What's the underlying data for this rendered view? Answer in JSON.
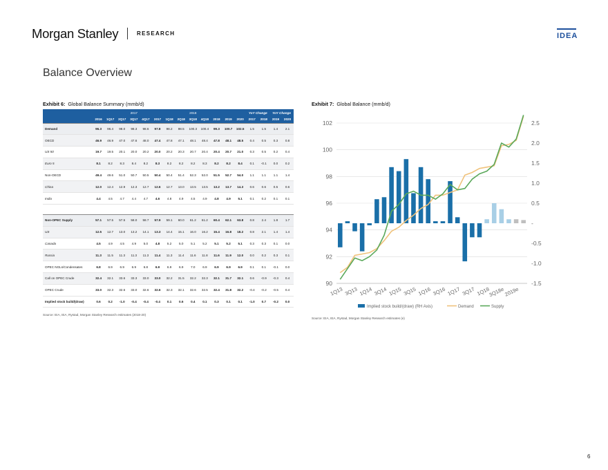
{
  "header": {
    "brand": "Morgan Stanley",
    "section": "RESEARCH",
    "tag": "IDEA"
  },
  "page_title": "Balance Overview",
  "exhibit6": {
    "label": "Exhibit 6:",
    "title": "Global Balance Summary (mmb/d)",
    "source": "Source: EIA, IEA, Rystad, Morgan Stanley Research estimates (2018-20)",
    "group_headers": [
      "2017",
      "2018",
      "YoY Change",
      "YoY Change"
    ],
    "columns": [
      "2016",
      "1Q17",
      "2Q17",
      "3Q17",
      "4Q17",
      "2017",
      "1Q18",
      "2Q18",
      "3Q18",
      "4Q18",
      "2018",
      "2019",
      "2020",
      "2017",
      "2018",
      "2019",
      "2020"
    ],
    "rows": [
      {
        "label": "Demand",
        "values": [
          "96.3",
          "96.4",
          "98.0",
          "98.3",
          "98.6",
          "97.8",
          "98.2",
          "98.5",
          "100.3",
          "100.4",
          "99.3",
          "100.7",
          "102.5",
          "1.5",
          "1.5",
          "1.4",
          "2.1"
        ]
      },
      {
        "label": "OECD",
        "values": [
          "46.9",
          "46.9",
          "47.0",
          "47.6",
          "48.0",
          "47.4",
          "47.8",
          "47.1",
          "48.1",
          "48.4",
          "47.8",
          "48.1",
          "48.5",
          "0.4",
          "0.5",
          "0.3",
          "0.8"
        ]
      },
      {
        "label": "US 50",
        "values": [
          "19.7",
          "19.5",
          "20.1",
          "20.0",
          "20.2",
          "20.0",
          "20.2",
          "20.3",
          "20.7",
          "20.4",
          "20.4",
          "20.7",
          "21.0",
          "0.3",
          "0.5",
          "0.2",
          "0.4"
        ]
      },
      {
        "label": "Euro 5",
        "values": [
          "8.1",
          "8.2",
          "8.3",
          "8.4",
          "8.2",
          "8.3",
          "8.2",
          "8.2",
          "8.2",
          "8.3",
          "8.2",
          "8.2",
          "8.4",
          "0.1",
          "-0.1",
          "0.0",
          "0.2"
        ]
      },
      {
        "label": "Non-OECD",
        "values": [
          "49.4",
          "49.6",
          "51.0",
          "50.7",
          "50.5",
          "50.4",
          "50.4",
          "51.4",
          "52.3",
          "52.0",
          "51.5",
          "52.7",
          "54.0",
          "1.1",
          "1.1",
          "1.1",
          "1.4"
        ]
      },
      {
        "label": "China",
        "values": [
          "12.0",
          "12.4",
          "12.9",
          "12.3",
          "12.7",
          "12.6",
          "12.7",
          "13.0",
          "13.5",
          "13.5",
          "13.2",
          "13.7",
          "14.3",
          "0.6",
          "0.6",
          "0.5",
          "0.6"
        ]
      },
      {
        "label": "India",
        "values": [
          "4.4",
          "4.5",
          "4.7",
          "4.4",
          "4.7",
          "4.6",
          "4.8",
          "4.9",
          "4.5",
          "4.9",
          "4.8",
          "4.9",
          "5.1",
          "0.1",
          "0.2",
          "0.1",
          "0.1"
        ]
      },
      {
        "label": "Non-OPEC Supply",
        "values": [
          "57.1",
          "57.5",
          "57.5",
          "58.0",
          "58.7",
          "57.9",
          "59.1",
          "60.0",
          "61.2",
          "61.2",
          "60.4",
          "62.1",
          "63.8",
          "0.8",
          "2.4",
          "1.8",
          "1.7"
        ]
      },
      {
        "label": "US",
        "values": [
          "12.5",
          "12.7",
          "13.0",
          "13.2",
          "14.1",
          "13.3",
          "14.4",
          "15.1",
          "16.0",
          "16.2",
          "15.4",
          "16.8",
          "18.2",
          "0.8",
          "2.1",
          "1.4",
          "1.4"
        ]
      },
      {
        "label": "Canada",
        "values": [
          "4.5",
          "4.9",
          "4.5",
          "4.9",
          "5.0",
          "4.8",
          "5.2",
          "5.0",
          "5.1",
          "5.2",
          "5.1",
          "5.2",
          "5.1",
          "0.3",
          "0.3",
          "0.1",
          "0.0"
        ]
      },
      {
        "label": "Russia",
        "values": [
          "11.3",
          "11.5",
          "11.3",
          "11.3",
          "11.3",
          "11.4",
          "11.3",
          "11.4",
          "11.6",
          "11.8",
          "11.6",
          "11.9",
          "12.0",
          "0.0",
          "0.2",
          "0.3",
          "0.1"
        ]
      },
      {
        "label": "OPEC NGLs/Condensates",
        "values": [
          "6.8",
          "6.9",
          "6.9",
          "6.9",
          "6.8",
          "6.9",
          "6.9",
          "6.9",
          "7.0",
          "6.9",
          "6.9",
          "6.9",
          "6.9",
          "0.1",
          "0.1",
          "-0.1",
          "0.0"
        ]
      },
      {
        "label": "Call on OPEC Crude",
        "values": [
          "32.4",
          "32.1",
          "33.6",
          "33.3",
          "33.0",
          "33.0",
          "32.2",
          "31.5",
          "32.2",
          "32.3",
          "32.1",
          "31.7",
          "32.1",
          "0.6",
          "-0.9",
          "-0.3",
          "0.4"
        ]
      },
      {
        "label": "OPEC Crude",
        "values": [
          "33.0",
          "32.3",
          "32.6",
          "33.0",
          "32.6",
          "32.6",
          "32.3",
          "32.1",
          "32.6",
          "32.5",
          "32.4",
          "31.8",
          "32.2",
          "-0.4",
          "-0.2",
          "-0.5",
          "0.4"
        ]
      },
      {
        "label": "Implied stock build/(draw)",
        "values": [
          "0.6",
          "0.2",
          "-1.0",
          "-0.4",
          "-0.4",
          "-0.4",
          "0.1",
          "0.6",
          "0.4",
          "0.1",
          "0.3",
          "0.1",
          "0.1",
          "-1.0",
          "0.7",
          "-0.2",
          "0.0"
        ]
      }
    ]
  },
  "exhibit7": {
    "label": "Exhibit 7:",
    "title": "Global Balance (mmb/d)",
    "source": "Source: EIA, IEA, Rystad, Morgan Stanley Research estimates (e)"
  },
  "chart_data": {
    "type": "bar",
    "x": [
      "1Q13",
      "2Q13",
      "3Q13",
      "4Q13",
      "1Q14",
      "2Q14",
      "3Q14",
      "4Q14",
      "1Q15",
      "2Q15",
      "3Q15",
      "4Q15",
      "1Q16",
      "2Q16",
      "3Q16",
      "4Q16",
      "1Q17",
      "2Q17",
      "3Q17",
      "4Q17",
      "1Q18",
      "2Q18",
      "3Q18e",
      "4Q18e",
      "2019e",
      "2020e"
    ],
    "x_tick_labels": [
      "1Q13",
      "3Q13",
      "1Q14",
      "3Q14",
      "1Q15",
      "3Q15",
      "1Q16",
      "3Q16",
      "1Q17",
      "3Q17",
      "1Q18",
      "3Q18e",
      "2019e"
    ],
    "left_axis": {
      "ylim": [
        90,
        102
      ],
      "ticks": [
        "90",
        "92",
        "94",
        "96",
        "98",
        "100",
        "102"
      ]
    },
    "right_axis": {
      "ylim": [
        -1.5,
        2.5
      ],
      "ticks": [
        "-1.5",
        "-1.0",
        "-0.5",
        "-",
        "0.5",
        "1.0",
        "1.5",
        "2.0",
        "2.5"
      ]
    },
    "series": [
      {
        "name": "Implied stock build/(draw) (RH Axis)",
        "axis": "right",
        "kind": "bar",
        "color": "#1a6fa8",
        "values": [
          -0.6,
          0.05,
          -0.2,
          -0.7,
          -0.05,
          0.6,
          0.65,
          1.4,
          1.3,
          1.6,
          0.75,
          1.4,
          1.1,
          0.05,
          0.05,
          1.05,
          0.15,
          -0.95,
          -0.35,
          -0.35,
          0.1,
          0.5,
          0.35,
          0.1,
          0.1,
          0.08
        ],
        "faded_from_index": 20
      },
      {
        "name": "Demand",
        "axis": "left",
        "kind": "line",
        "color": "#f0c27b",
        "values": [
          90.8,
          91.2,
          92.1,
          92.2,
          92.3,
          92.6,
          93.2,
          93.9,
          94.2,
          94.7,
          95.1,
          95.6,
          95.9,
          96.6,
          96.6,
          96.8,
          97.0,
          98.1,
          98.3,
          98.6,
          98.7,
          98.8,
          100.3,
          100.4,
          100.7,
          102.5
        ]
      },
      {
        "name": "Supply",
        "axis": "left",
        "kind": "line",
        "color": "#5aa85a",
        "values": [
          90.3,
          91.1,
          91.9,
          91.7,
          92.0,
          92.5,
          93.6,
          95.4,
          95.9,
          96.7,
          96.9,
          96.6,
          96.6,
          96.3,
          96.7,
          97.4,
          97.0,
          97.1,
          97.8,
          98.2,
          98.4,
          98.9,
          100.5,
          100.2,
          100.8,
          102.6
        ]
      }
    ]
  },
  "page_number": "6"
}
